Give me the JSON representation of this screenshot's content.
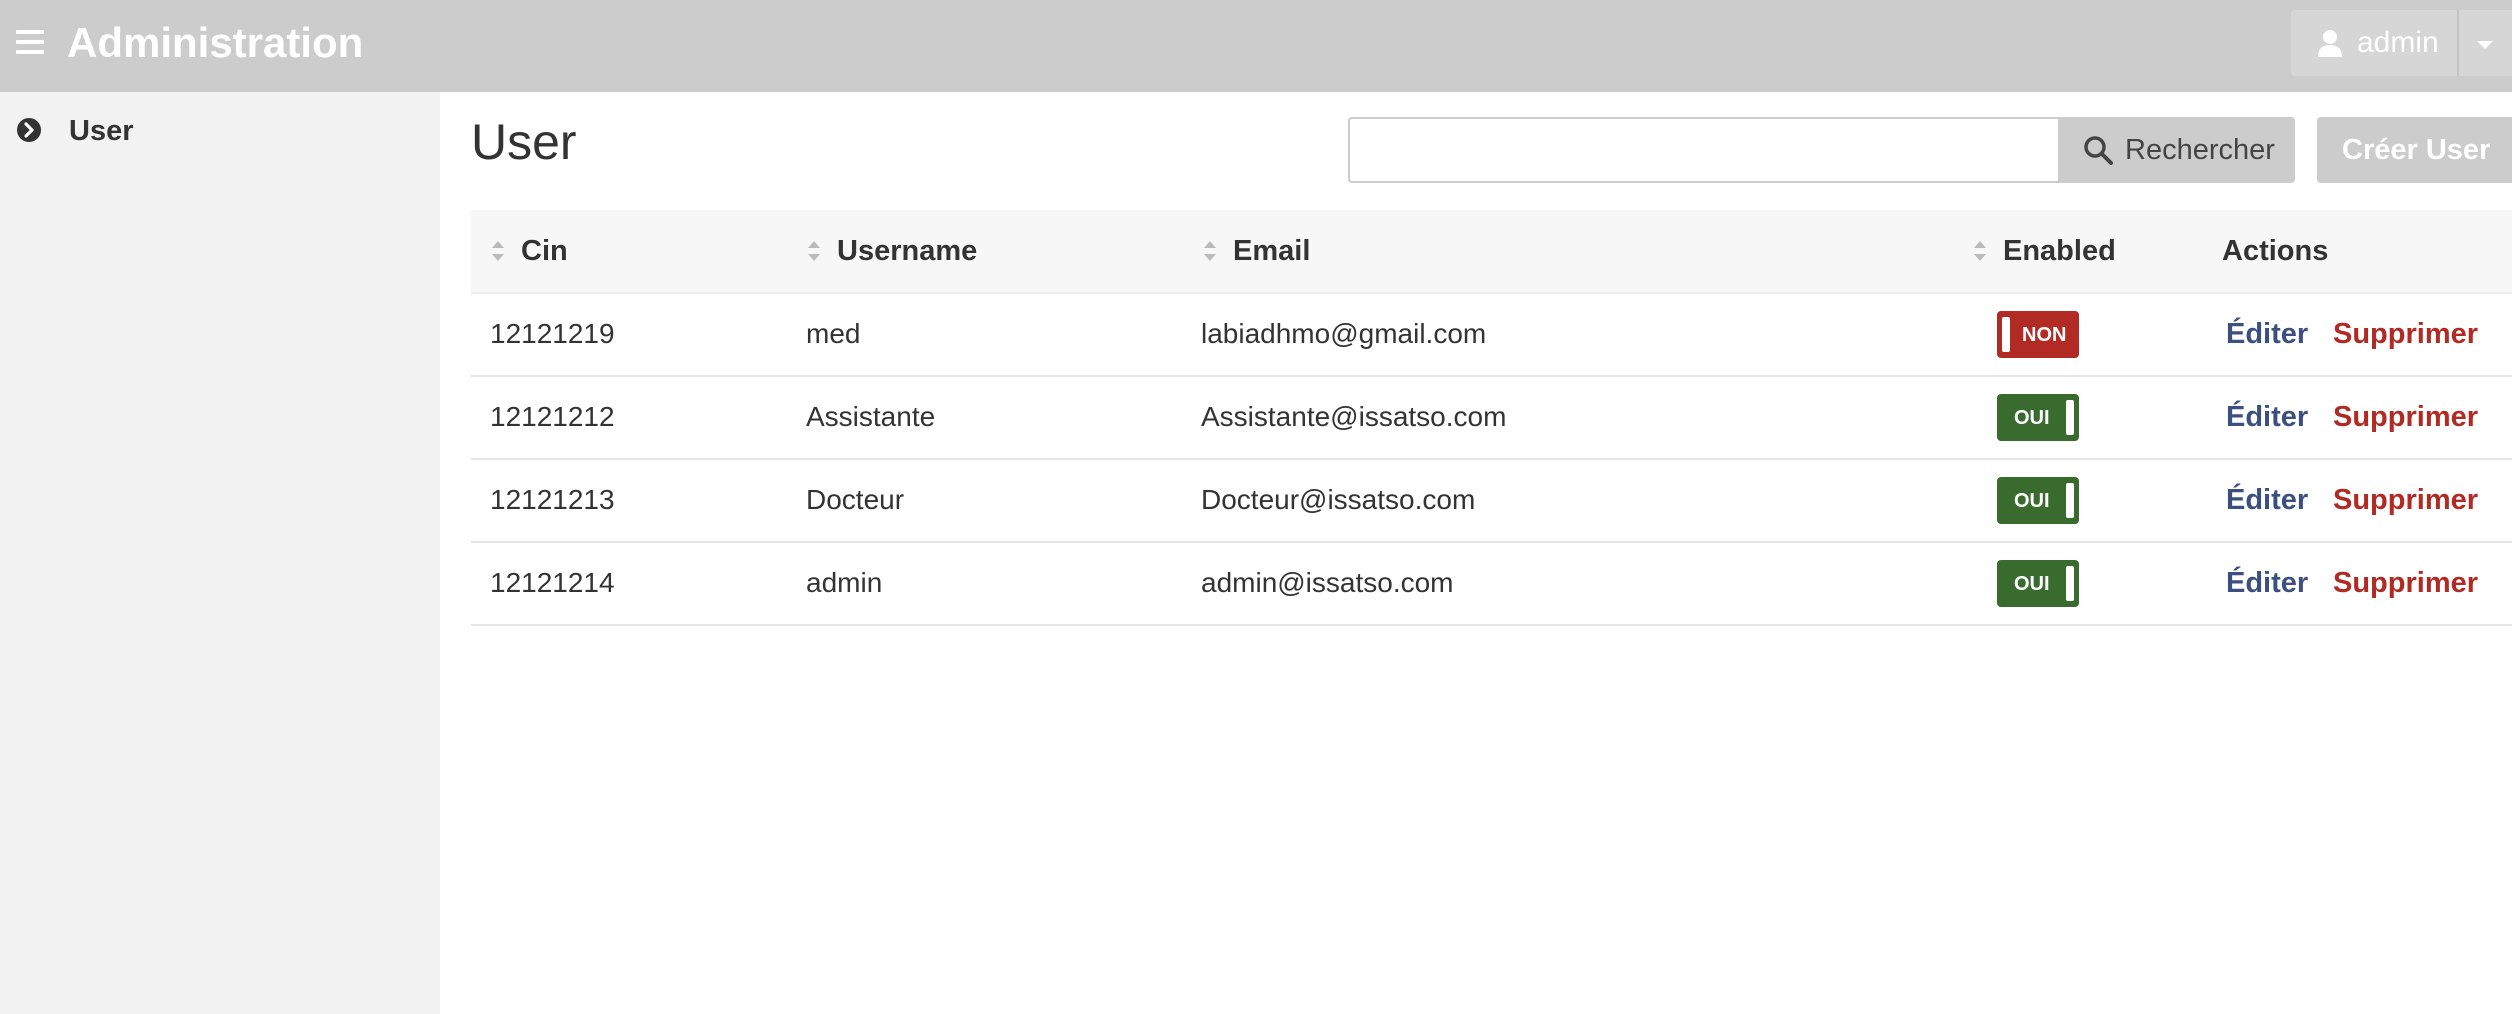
{
  "header": {
    "app_title": "Administration",
    "user_name": "admin",
    "menu_icon": "hamburger-icon",
    "user_icon": "user-icon",
    "dropdown_icon": "caret-down-icon"
  },
  "sidebar": {
    "items": [
      {
        "label": "User",
        "icon": "chevron-circle-right-icon",
        "active": true
      }
    ]
  },
  "main": {
    "title": "User",
    "search": {
      "value": "",
      "placeholder": "",
      "button_label": "Rechercher",
      "icon": "search-icon"
    },
    "create_button_label": "Créer User"
  },
  "table": {
    "columns": [
      "Cin",
      "Username",
      "Email",
      "Enabled",
      "Actions"
    ],
    "rows": [
      {
        "cin": "12121219",
        "username": "med",
        "email": "labiadhmo@gmail.com",
        "enabled_label": "NON",
        "enabled": false,
        "edit": "Éditer",
        "delete": "Supprimer"
      },
      {
        "cin": "12121212",
        "username": "Assistante",
        "email": "Assistante@issatso.com",
        "enabled_label": "OUI",
        "enabled": true,
        "edit": "Éditer",
        "delete": "Supprimer"
      },
      {
        "cin": "12121213",
        "username": "Docteur",
        "email": "Docteur@issatso.com",
        "enabled_label": "OUI",
        "enabled": true,
        "edit": "Éditer",
        "delete": "Supprimer"
      },
      {
        "cin": "12121214",
        "username": "admin",
        "email": "admin@issatso.com",
        "enabled_label": "OUI",
        "enabled": true,
        "edit": "Éditer",
        "delete": "Supprimer"
      }
    ]
  },
  "colors": {
    "header_bg": "#cccccc",
    "sidebar_bg": "#f2f2f2",
    "enabled_on": "#3a6b2e",
    "enabled_off": "#b22a24",
    "edit_link": "#3b5080",
    "delete_link": "#b22a24"
  }
}
